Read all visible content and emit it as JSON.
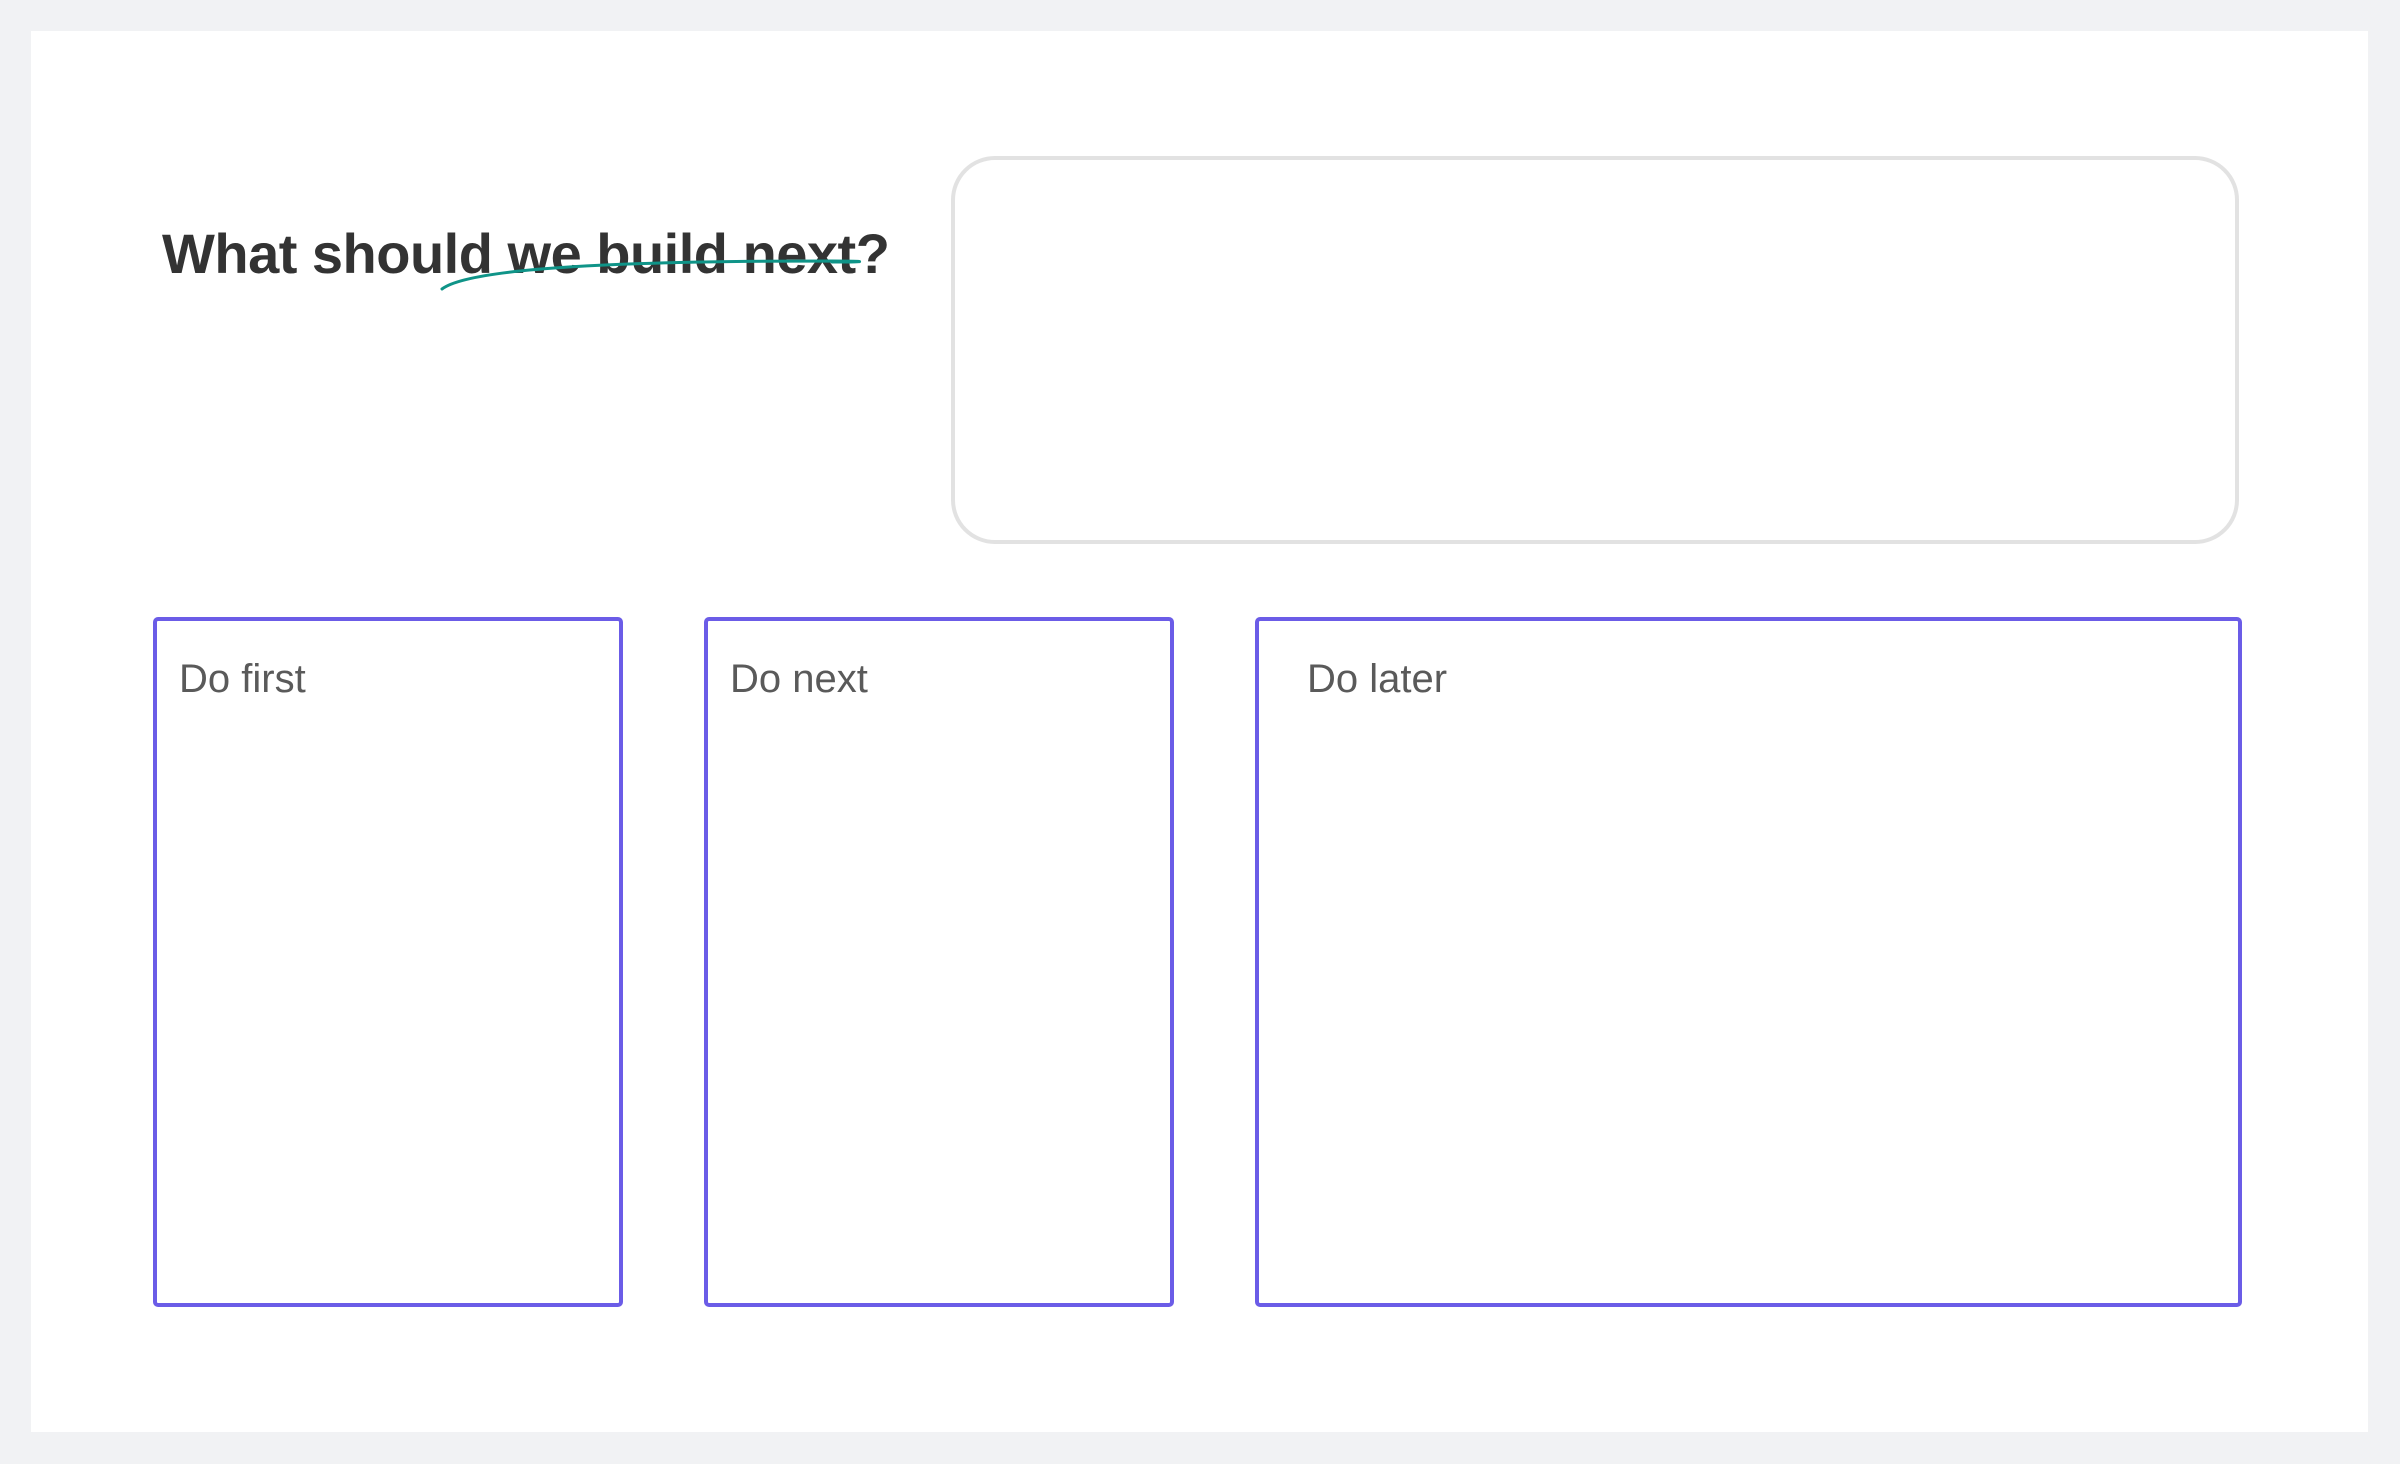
{
  "board": {
    "title": "What should we build next?",
    "accent_color": "#0f9488",
    "column_border_color": "#6b5ce7",
    "columns": [
      {
        "label": "Do first"
      },
      {
        "label": "Do next"
      },
      {
        "label": "Do later"
      }
    ]
  }
}
